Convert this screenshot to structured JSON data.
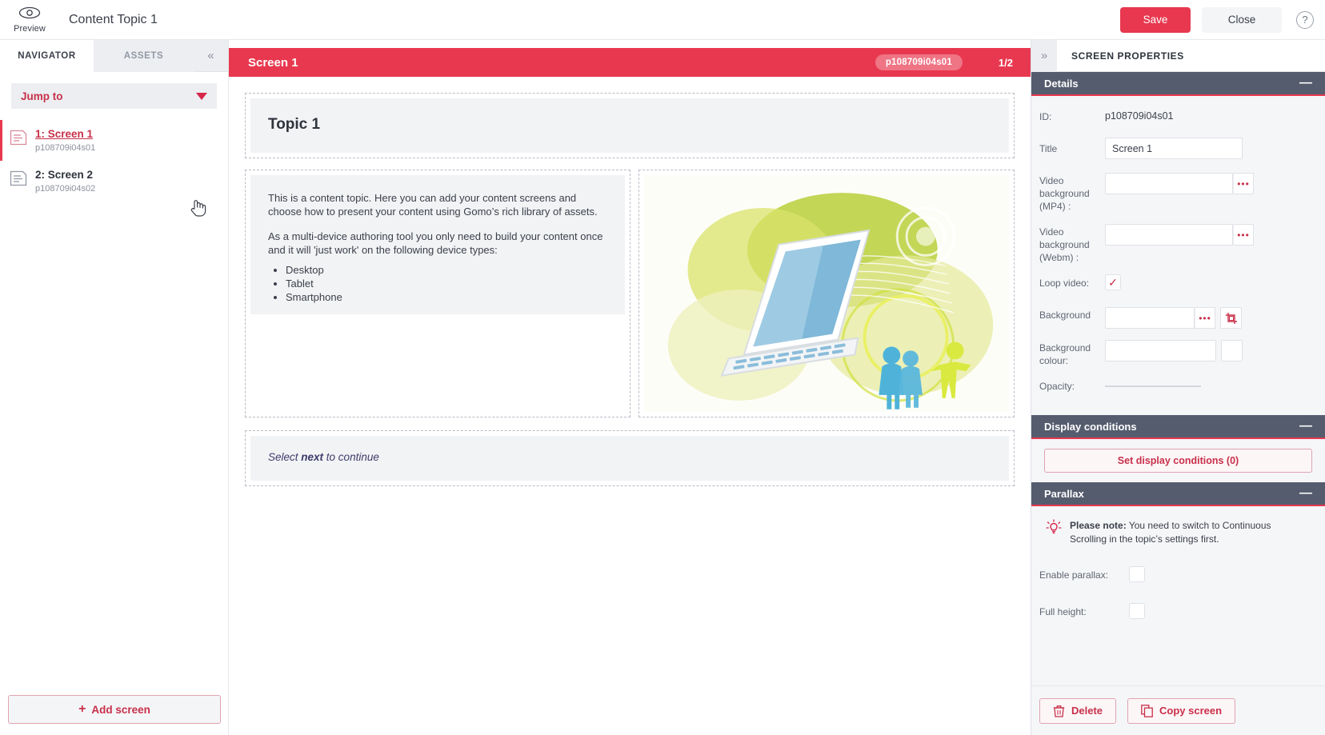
{
  "topbar": {
    "preview_label": "Preview",
    "topic_title": "Content Topic 1",
    "save_label": "Save",
    "close_label": "Close",
    "help_label": "?"
  },
  "left_panel": {
    "tab_navigator": "NAVIGATOR",
    "tab_assets": "ASSETS",
    "collapse_glyph": "«",
    "jump_to_label": "Jump to",
    "screens": [
      {
        "name": "1: Screen 1",
        "id": "p108709i04s01",
        "selected": true
      },
      {
        "name": "2: Screen 2",
        "id": "p108709i04s02",
        "selected": false
      }
    ],
    "add_screen_label": "Add screen",
    "add_screen_plus": "+"
  },
  "stage": {
    "screen_header_title": "Screen 1",
    "screen_id_badge": "p108709i04s01",
    "page_counter": "1/2",
    "topic_heading": "Topic 1",
    "paragraph_1": "This is a content topic. Here you can add your content screens and choose how to present your content using Gomo’s rich library of assets.",
    "paragraph_2": "As a multi-device authoring tool you only need to build your content once and it will 'just work' on the following device types:",
    "device_list": [
      "Desktop",
      "Tablet",
      "Smartphone"
    ],
    "cta_prefix": "Select ",
    "cta_bold": "next",
    "cta_suffix": " to continue"
  },
  "right_panel": {
    "expand_glyph": "»",
    "header_title": "SCREEN PROPERTIES",
    "sections": {
      "details": {
        "title": "Details",
        "minus": "—",
        "id_label": "ID:",
        "id_value": "p108709i04s01",
        "title_label": "Title",
        "title_value": "Screen 1",
        "video_mp4_label": "Video background (MP4) :",
        "video_mp4_value": "",
        "video_webm_label": "Video background (Webm) :",
        "video_webm_value": "",
        "loop_video_label": "Loop video:",
        "loop_video_checked": "✓",
        "background_label": "Background",
        "background_value": "",
        "background_colour_label": "Background colour:",
        "background_colour_value": "",
        "opacity_label": "Opacity:",
        "dots_glyph": "•••"
      },
      "display_conditions": {
        "title": "Display conditions",
        "minus": "—",
        "button_label": "Set display conditions (0)"
      },
      "parallax": {
        "title": "Parallax",
        "minus": "—",
        "note_bold": "Please note:",
        "note_text": " You need to switch to Continuous Scrolling in the topic’s settings first.",
        "enable_parallax_label": "Enable parallax:",
        "full_height_label": "Full height:"
      }
    },
    "footer": {
      "delete_label": "Delete",
      "copy_screen_label": "Copy screen"
    }
  },
  "colors": {
    "accent_red": "#e8384f",
    "link_red": "#c8304a",
    "section_header": "#555c6e",
    "panel_bg": "#f5f6f8"
  }
}
